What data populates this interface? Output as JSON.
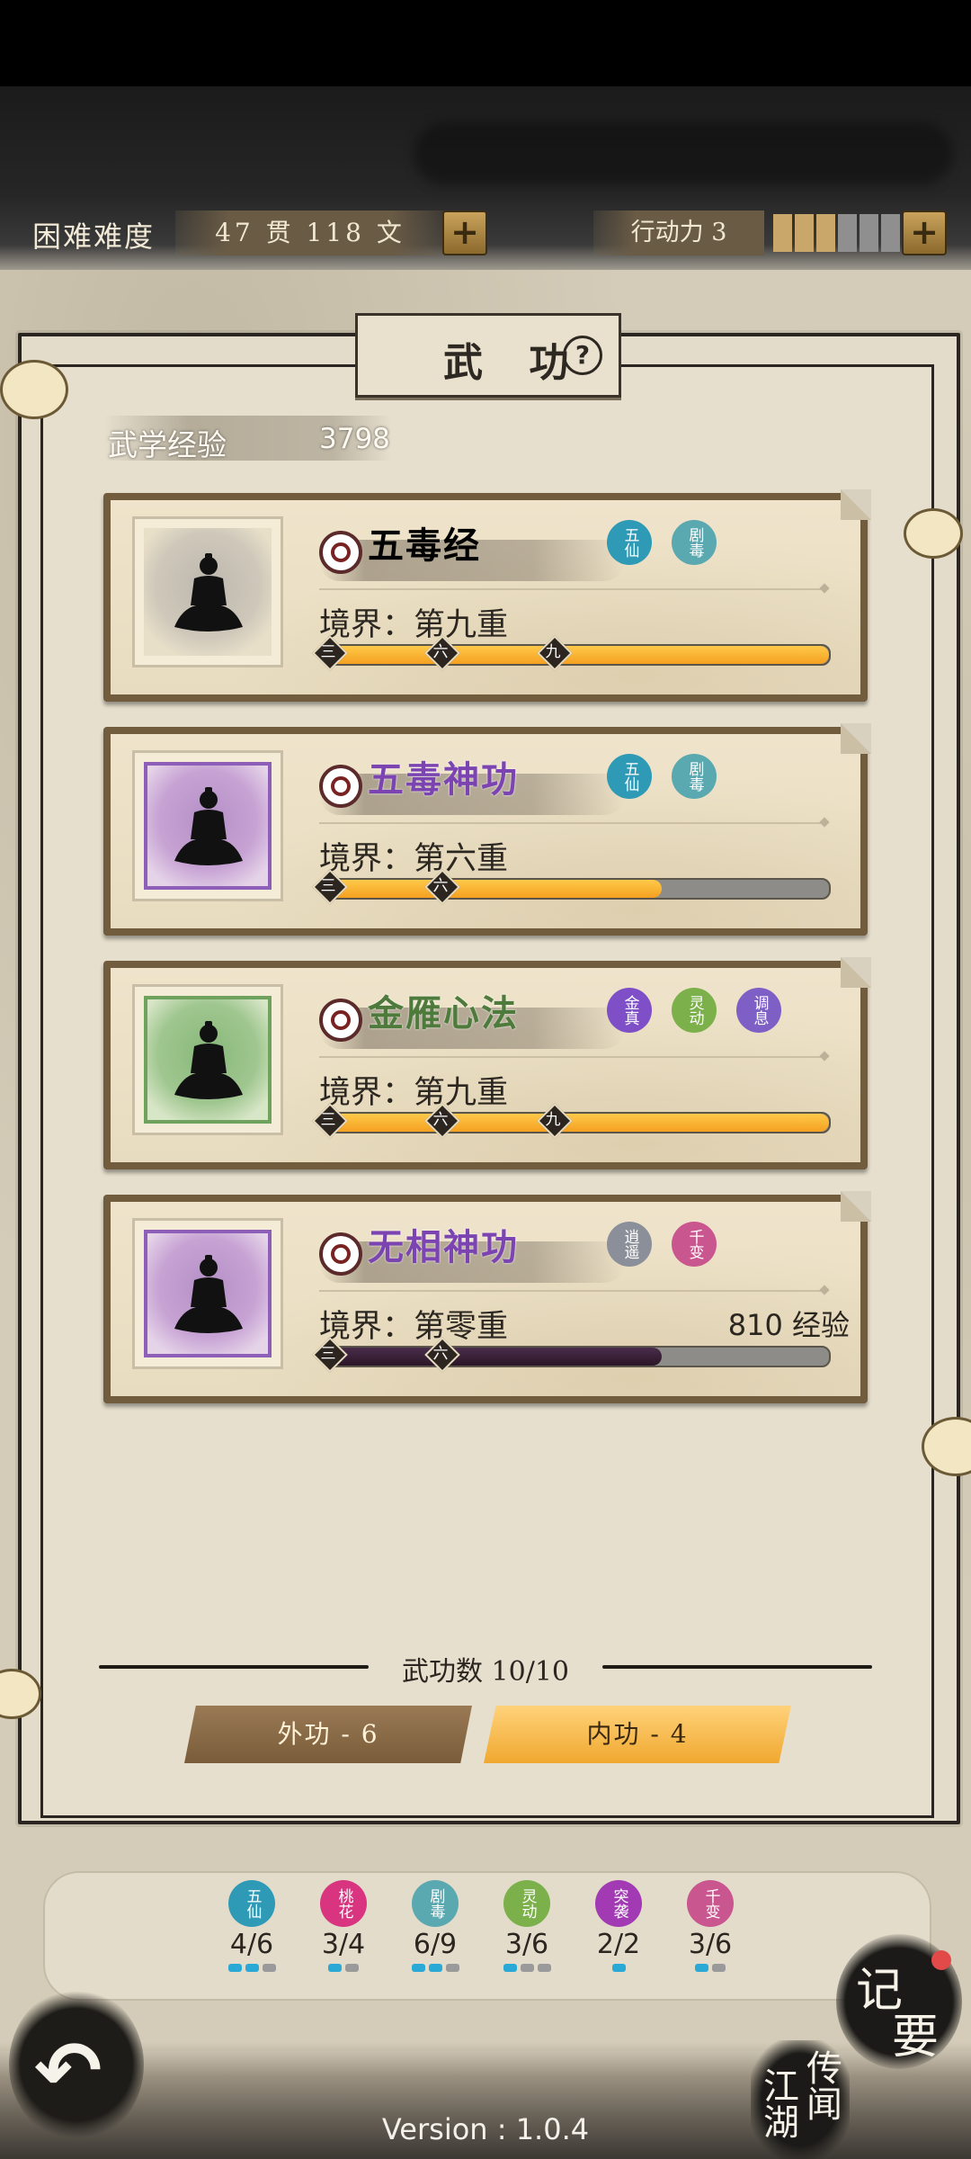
{
  "hud": {
    "difficulty": "困难难度",
    "money": "47 贯 118 文",
    "add_money_label": "+",
    "stamina_label": "行动力 3",
    "stamina_current": 3,
    "stamina_max": 7,
    "add_stamina_label": "+"
  },
  "panel": {
    "title": "武 功",
    "help_label": "?",
    "exp_label": "武学经验",
    "exp_value": "3798"
  },
  "skills": [
    {
      "name": "五毒经",
      "name_color": "white",
      "portrait_tint": "gray",
      "badges": [
        {
          "text": "五仙",
          "color": "#2f9ab6"
        },
        {
          "text": "剧毒",
          "color": "#5aa8b0"
        }
      ],
      "realm": "境界：第九重",
      "progress": 1.0,
      "markers": [
        "三",
        "六",
        "九"
      ],
      "exp_text": ""
    },
    {
      "name": "五毒神功",
      "name_color": "purple",
      "portrait_tint": "purple",
      "badges": [
        {
          "text": "五仙",
          "color": "#2f9ab6"
        },
        {
          "text": "剧毒",
          "color": "#5aa8b0"
        }
      ],
      "realm": "境界：第六重",
      "progress": 0.667,
      "markers": [
        "三",
        "六"
      ],
      "exp_text": ""
    },
    {
      "name": "金雁心法",
      "name_color": "green",
      "portrait_tint": "green",
      "badges": [
        {
          "text": "金真",
          "color": "#7e4fc6"
        },
        {
          "text": "灵动",
          "color": "#7bb04a"
        },
        {
          "text": "调息",
          "color": "#7e5fc6"
        }
      ],
      "realm": "境界：第九重",
      "progress": 1.0,
      "markers": [
        "三",
        "六",
        "九"
      ],
      "exp_text": ""
    },
    {
      "name": "无相神功",
      "name_color": "purple",
      "portrait_tint": "purple",
      "badges": [
        {
          "text": "逍遥",
          "color": "#8a8f99"
        },
        {
          "text": "千变",
          "color": "#c9568e"
        }
      ],
      "realm": "境界：第零重",
      "progress": 0.667,
      "markers": [
        "三",
        "六"
      ],
      "exp_text": "810 经验"
    }
  ],
  "footer": {
    "count_text": "武功数 10/10",
    "tab_outer": "外功 - 6",
    "tab_inner": "内功 - 4"
  },
  "factions": [
    {
      "text": "五仙",
      "color": "#2f9ab6",
      "count": "4/6",
      "dots_on": 2,
      "dots_total": 3
    },
    {
      "text": "桃花",
      "color": "#d8347f",
      "count": "3/4",
      "dots_on": 1,
      "dots_total": 2
    },
    {
      "text": "剧毒",
      "color": "#5aa8b0",
      "count": "6/9",
      "dots_on": 2,
      "dots_total": 3
    },
    {
      "text": "灵动",
      "color": "#7bb04a",
      "count": "3/6",
      "dots_on": 1,
      "dots_total": 3
    },
    {
      "text": "突袭",
      "color": "#a13ab3",
      "count": "2/2",
      "dots_on": 1,
      "dots_total": 1
    },
    {
      "text": "千变",
      "color": "#c9568e",
      "count": "3/6",
      "dots_on": 1,
      "dots_total": 2
    }
  ],
  "bottom": {
    "back_icon": "back-arrow-icon",
    "jiyao_1": "记",
    "jiyao_2": "要",
    "jianghu_col1": "江湖",
    "jianghu_col2": "传闻",
    "version": "Version : 1.0.4"
  }
}
